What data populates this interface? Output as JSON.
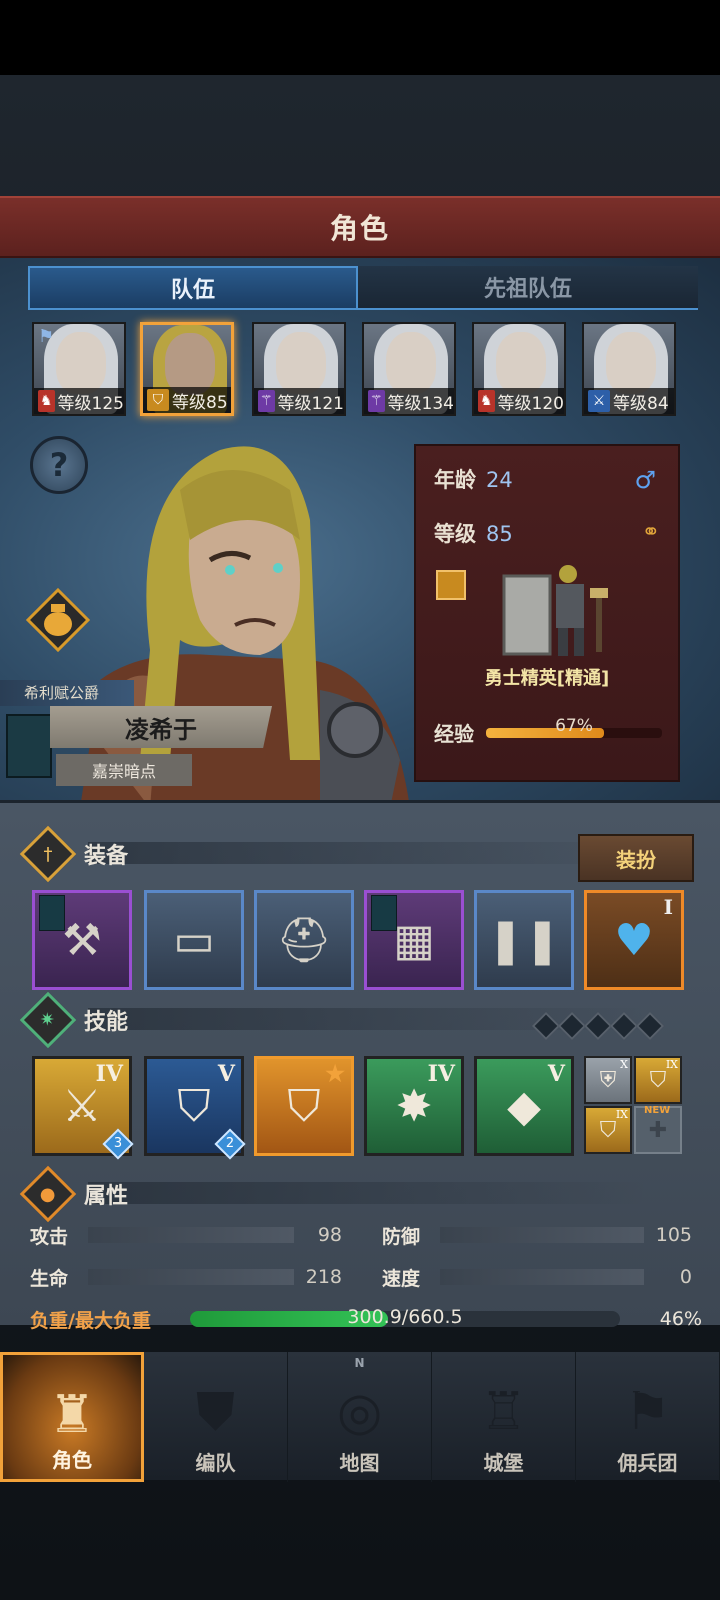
{
  "header": {
    "title": "角色"
  },
  "tabs": [
    {
      "label": "队伍",
      "active": true
    },
    {
      "label": "先祖队伍",
      "active": false
    }
  ],
  "heroes": [
    {
      "level_label": "等级125",
      "class_icon": "horse-icon",
      "class_color": "red",
      "selected": false,
      "hair": "silver",
      "flag": true
    },
    {
      "level_label": "等级85",
      "class_icon": "shield-star-icon",
      "class_color": "gold",
      "selected": true,
      "hair": "blond",
      "flag": false
    },
    {
      "level_label": "等级121",
      "class_icon": "staff-icon",
      "class_color": "purple",
      "selected": false,
      "hair": "silver",
      "flag": false
    },
    {
      "level_label": "等级134",
      "class_icon": "staff-icon",
      "class_color": "purple",
      "selected": false,
      "hair": "silver",
      "flag": false
    },
    {
      "level_label": "等级120",
      "class_icon": "horse-icon",
      "class_color": "red",
      "selected": false,
      "hair": "silver",
      "flag": false
    },
    {
      "level_label": "等级84",
      "class_icon": "sword-icon",
      "class_color": "blue",
      "selected": false,
      "hair": "silver",
      "flag": false
    }
  ],
  "character": {
    "noble_title": "希利赋公爵",
    "name": "凌希于",
    "guild": "嘉崇暗点",
    "age_label": "年龄",
    "age": "24",
    "level_label": "等级",
    "level": "85",
    "class_name": "勇士精英[精通]",
    "exp_label": "经验",
    "exp_text": "67%",
    "exp_fraction": 0.67
  },
  "equipment": {
    "title": "装备",
    "dress_button": "装扮",
    "slots": [
      {
        "item": "pickaxe-hammer-icon",
        "rarity": "purple",
        "banner": true
      },
      {
        "item": "tower-shield-icon",
        "rarity": "blue",
        "banner": false
      },
      {
        "item": "helmet-icon",
        "rarity": "blue",
        "banner": false
      },
      {
        "item": "chain-armor-icon",
        "rarity": "purple",
        "banner": true
      },
      {
        "item": "greaves-icon",
        "rarity": "blue",
        "banner": false
      },
      {
        "item": "heart-amulet-icon",
        "rarity": "orange",
        "banner": false,
        "rank": "I"
      }
    ]
  },
  "skills": {
    "title": "技能",
    "items": [
      {
        "icon": "shield-sword-icon",
        "color": "gold",
        "rank": "IV",
        "count": "3"
      },
      {
        "icon": "shield-bash-icon",
        "color": "blue",
        "rank": "V",
        "count": "2"
      },
      {
        "icon": "dragon-shield-icon",
        "color": "orange",
        "rank": "★",
        "count": ""
      },
      {
        "icon": "crystal-burst-icon",
        "color": "green",
        "rank": "IV",
        "count": ""
      },
      {
        "icon": "crystal-icon",
        "color": "green",
        "rank": "V",
        "count": ""
      }
    ],
    "mini": [
      {
        "icon": "shield-cross-icon",
        "color": "gray",
        "rank": "X"
      },
      {
        "icon": "shield-bash-icon",
        "color": "gold",
        "rank": "IX"
      },
      {
        "icon": "shield-bash-icon",
        "color": "gold",
        "rank": "IX"
      },
      {
        "icon": "cross-icon",
        "color": "empty",
        "rank": ""
      }
    ],
    "new_badge": "NEW"
  },
  "attributes": {
    "title": "属性",
    "attack_label": "攻击",
    "attack": "98",
    "defense_label": "防御",
    "defense": "105",
    "hp_label": "生命",
    "hp": "218",
    "speed_label": "速度",
    "speed": "0",
    "load_label": "负重/最大负重",
    "load_text": "300.9/660.5",
    "load_pct": "46%",
    "load_fraction": 0.46
  },
  "nav": [
    {
      "label": "角色",
      "icon": "knight-icon",
      "active": true
    },
    {
      "label": "编队",
      "icon": "formation-icon",
      "active": false
    },
    {
      "label": "地图",
      "icon": "compass-map-icon",
      "active": false
    },
    {
      "label": "城堡",
      "icon": "castle-icon",
      "active": false
    },
    {
      "label": "佣兵团",
      "icon": "mercenary-banner-icon",
      "active": false
    }
  ]
}
